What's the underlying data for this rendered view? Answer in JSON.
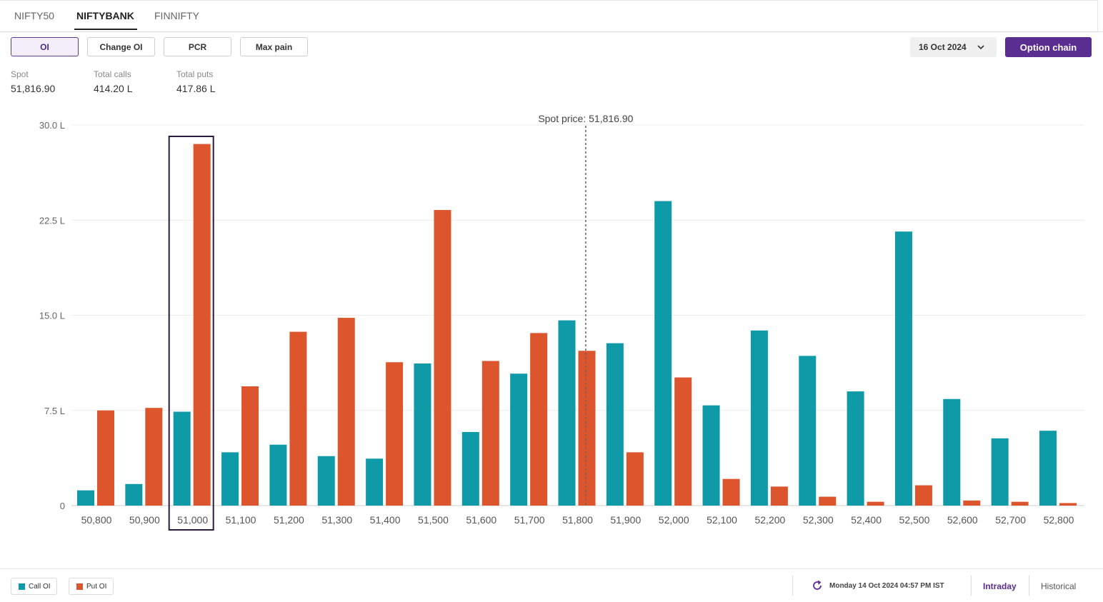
{
  "tabs": [
    {
      "label": "NIFTY50",
      "active": false
    },
    {
      "label": "NIFTYBANK",
      "active": true
    },
    {
      "label": "FINNIFTY",
      "active": false
    }
  ],
  "toolbar": {
    "buttons": [
      {
        "label": "OI",
        "active": true
      },
      {
        "label": "Change OI",
        "active": false
      },
      {
        "label": "PCR",
        "active": false
      },
      {
        "label": "Max pain",
        "active": false
      }
    ],
    "date": "16 Oct 2024",
    "option_chain": "Option chain"
  },
  "stats": {
    "spot_label": "Spot",
    "spot_value": "51,816.90",
    "calls_label": "Total calls",
    "calls_value": "414.20 L",
    "puts_label": "Total puts",
    "puts_value": "417.86 L"
  },
  "chart_data": {
    "type": "bar",
    "categories": [
      "50,800",
      "50,900",
      "51,000",
      "51,100",
      "51,200",
      "51,300",
      "51,400",
      "51,500",
      "51,600",
      "51,700",
      "51,800",
      "51,900",
      "52,000",
      "52,100",
      "52,200",
      "52,300",
      "52,400",
      "52,500",
      "52,600",
      "52,700",
      "52,800"
    ],
    "series": [
      {
        "name": "Call OI",
        "color": "#0f9aa8",
        "values": [
          1.2,
          1.7,
          7.4,
          4.2,
          4.8,
          3.9,
          3.7,
          11.2,
          5.8,
          10.4,
          14.6,
          12.8,
          24.0,
          7.9,
          13.8,
          11.8,
          9.0,
          21.6,
          8.4,
          5.3,
          5.9
        ]
      },
      {
        "name": "Put OI",
        "color": "#dc552c",
        "values": [
          7.5,
          7.7,
          28.5,
          9.4,
          13.7,
          14.8,
          11.3,
          23.3,
          11.4,
          13.6,
          12.2,
          4.2,
          10.1,
          2.1,
          1.5,
          0.7,
          0.3,
          1.6,
          0.4,
          0.3,
          0.2
        ]
      }
    ],
    "ylim": [
      0,
      30
    ],
    "y_ticks": [
      0,
      7.5,
      15,
      22.5,
      30
    ],
    "y_tick_labels": [
      "0",
      "7.5 L",
      "15.0 L",
      "22.5 L",
      "30.0 L"
    ],
    "spot": 51816.9,
    "spot_label": "Spot price: 51,816.90",
    "highlight_category": "51,000",
    "grid": true
  },
  "footer": {
    "legend": [
      {
        "label": "Call OI",
        "color": "#0f9aa8"
      },
      {
        "label": "Put OI",
        "color": "#dc552c"
      }
    ],
    "timestamp": "Monday 14 Oct 2024 04:57 PM IST",
    "modes": [
      {
        "label": "Intraday",
        "active": true
      },
      {
        "label": "Historical",
        "active": false
      }
    ]
  }
}
